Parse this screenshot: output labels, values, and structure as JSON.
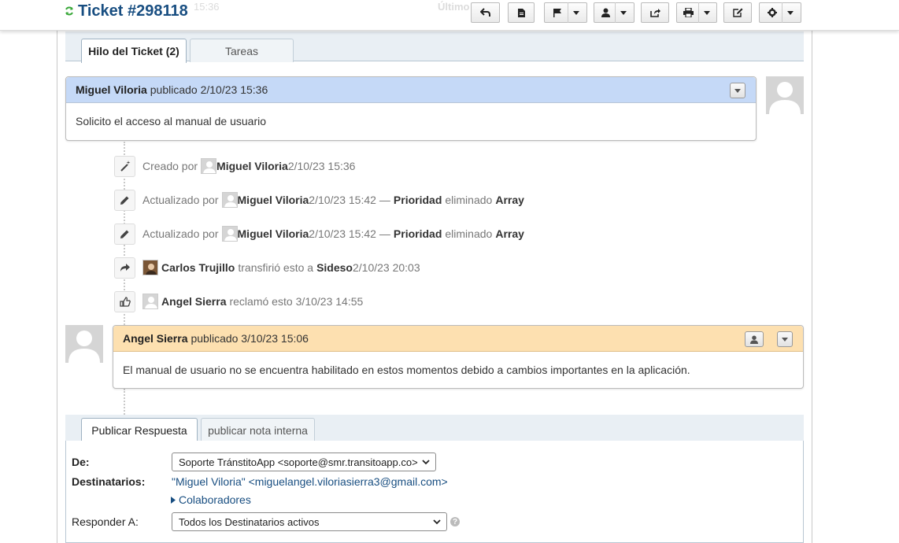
{
  "header": {
    "ticket_title": "Ticket #298118",
    "ghost_time": "15:36",
    "ghost_label": "Último"
  },
  "tabs": [
    {
      "label": "Hilo del Ticket (2)",
      "active": true
    },
    {
      "label": "Tareas",
      "active": false
    }
  ],
  "thread": {
    "first_post": {
      "author": "Miguel Viloria",
      "meta": "publicado 2/10/23 15:36",
      "body": "Solicito el acceso al manual de usuario"
    },
    "events": [
      {
        "verb": "Creado por",
        "user": "Miguel Viloria",
        "time": "2/10/23 15:36",
        "icon": "magic-wand-icon"
      },
      {
        "verb": "Actualizado por",
        "user": "Miguel Viloria",
        "time": "2/10/23 15:42",
        "dash": "—",
        "field": "Prioridad",
        "action": "eliminado",
        "value": "Array",
        "icon": "pencil-icon"
      },
      {
        "verb": "Actualizado por",
        "user": "Miguel Viloria",
        "time": "2/10/23 15:42",
        "dash": "—",
        "field": "Prioridad",
        "action": "eliminado",
        "value": "Array",
        "icon": "pencil-icon"
      },
      {
        "user": "Carlos Trujillo",
        "verb": "transfirió esto a",
        "target": "Sideso",
        "time": "2/10/23 20:03",
        "icon": "share-arrow-icon"
      },
      {
        "user": "Angel Sierra",
        "verb": "reclamó esto",
        "time": "3/10/23 14:55",
        "icon": "thumbs-up-icon"
      }
    ],
    "reply_post": {
      "author": "Angel Sierra",
      "meta": "publicado 3/10/23 15:06",
      "body": "El manual de usuario no se encuentra habilitado en estos momentos debido a cambios importantes en la aplicación."
    }
  },
  "reply_tabs": [
    {
      "label": "Publicar Respuesta",
      "active": true
    },
    {
      "label": "publicar nota interna",
      "active": false
    }
  ],
  "form": {
    "from_label": "De:",
    "from_value": "Soporte TránstitoApp <soporte@smr.transitoapp.co>",
    "recipients_label": "Destinatarios:",
    "recipients_value": "\"Miguel Viloria\" <miguelangel.viloriasierra3@gmail.com>",
    "collaborators_label": "Colaboradores",
    "reply_to_label": "Responder A:",
    "reply_to_value": "Todos los Destinatarios activos",
    "help_symbol": "?"
  },
  "colors": {
    "title_blue": "#184e81",
    "post_header_blue": "#c5d9f7",
    "post_header_orange": "#fde0b0",
    "refresh_green": "#4caf50"
  }
}
